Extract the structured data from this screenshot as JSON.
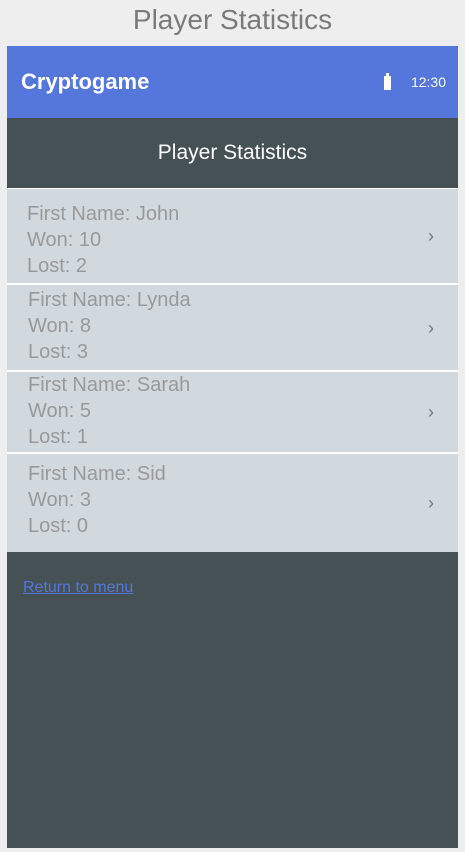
{
  "page_title": "Player Statistics",
  "app_bar": {
    "title": "Cryptogame",
    "time": "12:30",
    "battery_icon": "battery-icon"
  },
  "header": {
    "title": "Player Statistics"
  },
  "players": [
    {
      "first_name_label": "First Name: John",
      "won_label": "Won: 10",
      "lost_label": "Lost: 2"
    },
    {
      "first_name_label": "First Name: Lynda",
      "won_label": "Won: 8",
      "lost_label": "Lost: 3"
    },
    {
      "first_name_label": "First Name: Sarah",
      "won_label": "Won: 5",
      "lost_label": "Lost: 1"
    },
    {
      "first_name_label": "First Name: Sid",
      "won_label": "Won: 3",
      "lost_label": "Lost: 0"
    }
  ],
  "chevron_glyph": "›",
  "return_link": "Return to menu",
  "colors": {
    "app_bar": "#5577db",
    "background": "#465155",
    "list_item": "#d1d9df",
    "link": "#5577db"
  }
}
